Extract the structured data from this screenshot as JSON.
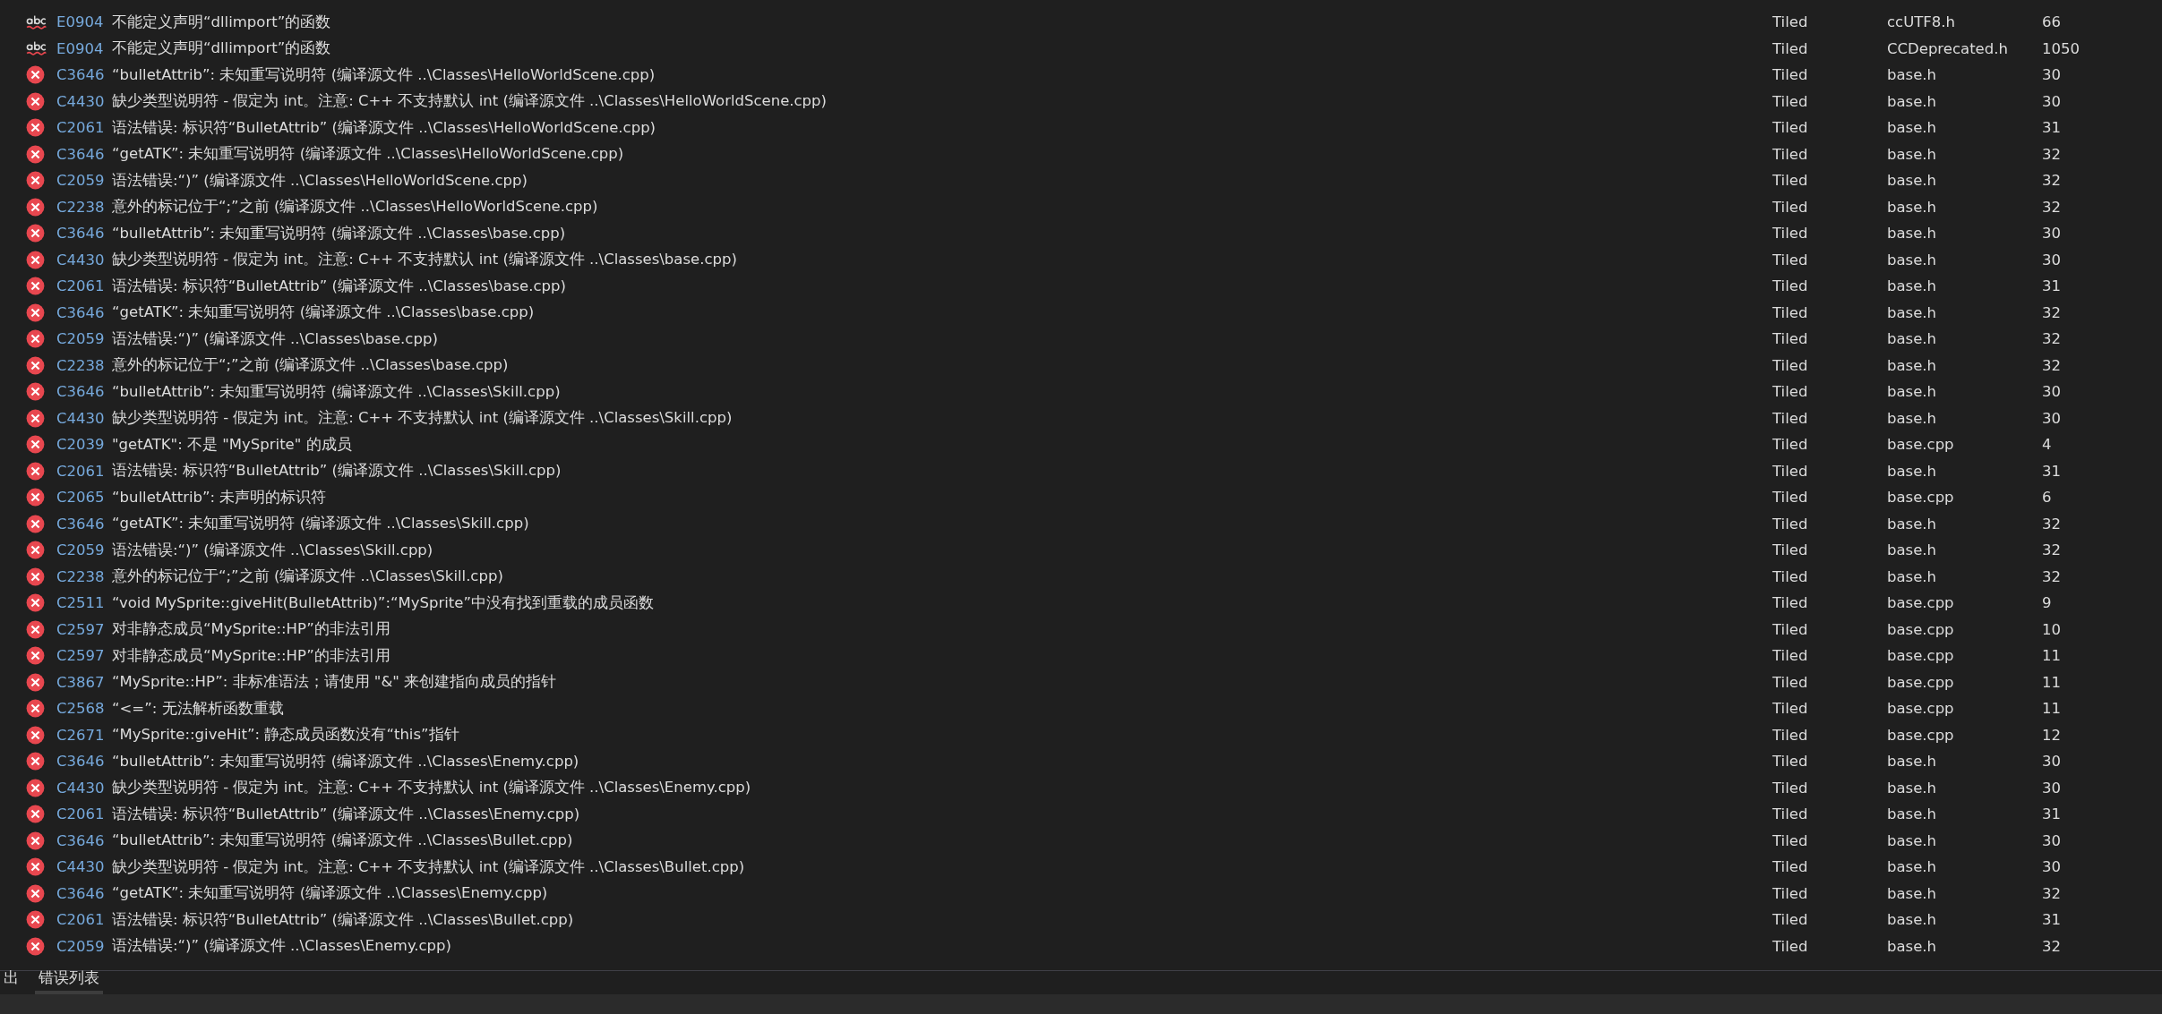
{
  "rows": [
    {
      "kind": "intellisense",
      "code": "E0904",
      "description": "不能定义声明“dllimport”的函数",
      "project": "Tiled",
      "file": "ccUTF8.h",
      "line": "66"
    },
    {
      "kind": "intellisense",
      "code": "E0904",
      "description": "不能定义声明“dllimport”的函数",
      "project": "Tiled",
      "file": "CCDeprecated.h",
      "line": "1050"
    },
    {
      "kind": "error",
      "code": "C3646",
      "description": "“bulletAttrib”: 未知重写说明符 (编译源文件 ..\\Classes\\HelloWorldScene.cpp)",
      "project": "Tiled",
      "file": "base.h",
      "line": "30"
    },
    {
      "kind": "error",
      "code": "C4430",
      "description": "缺少类型说明符 - 假定为 int。注意: C++ 不支持默认 int (编译源文件 ..\\Classes\\HelloWorldScene.cpp)",
      "project": "Tiled",
      "file": "base.h",
      "line": "30"
    },
    {
      "kind": "error",
      "code": "C2061",
      "description": "语法错误: 标识符“BulletAttrib” (编译源文件 ..\\Classes\\HelloWorldScene.cpp)",
      "project": "Tiled",
      "file": "base.h",
      "line": "31"
    },
    {
      "kind": "error",
      "code": "C3646",
      "description": "“getATK”: 未知重写说明符 (编译源文件 ..\\Classes\\HelloWorldScene.cpp)",
      "project": "Tiled",
      "file": "base.h",
      "line": "32"
    },
    {
      "kind": "error",
      "code": "C2059",
      "description": "语法错误:“)” (编译源文件 ..\\Classes\\HelloWorldScene.cpp)",
      "project": "Tiled",
      "file": "base.h",
      "line": "32"
    },
    {
      "kind": "error",
      "code": "C2238",
      "description": "意外的标记位于“;”之前 (编译源文件 ..\\Classes\\HelloWorldScene.cpp)",
      "project": "Tiled",
      "file": "base.h",
      "line": "32"
    },
    {
      "kind": "error",
      "code": "C3646",
      "description": "“bulletAttrib”: 未知重写说明符 (编译源文件 ..\\Classes\\base.cpp)",
      "project": "Tiled",
      "file": "base.h",
      "line": "30"
    },
    {
      "kind": "error",
      "code": "C4430",
      "description": "缺少类型说明符 - 假定为 int。注意: C++ 不支持默认 int (编译源文件 ..\\Classes\\base.cpp)",
      "project": "Tiled",
      "file": "base.h",
      "line": "30"
    },
    {
      "kind": "error",
      "code": "C2061",
      "description": "语法错误: 标识符“BulletAttrib” (编译源文件 ..\\Classes\\base.cpp)",
      "project": "Tiled",
      "file": "base.h",
      "line": "31"
    },
    {
      "kind": "error",
      "code": "C3646",
      "description": "“getATK”: 未知重写说明符 (编译源文件 ..\\Classes\\base.cpp)",
      "project": "Tiled",
      "file": "base.h",
      "line": "32"
    },
    {
      "kind": "error",
      "code": "C2059",
      "description": "语法错误:“)” (编译源文件 ..\\Classes\\base.cpp)",
      "project": "Tiled",
      "file": "base.h",
      "line": "32"
    },
    {
      "kind": "error",
      "code": "C2238",
      "description": "意外的标记位于“;”之前 (编译源文件 ..\\Classes\\base.cpp)",
      "project": "Tiled",
      "file": "base.h",
      "line": "32"
    },
    {
      "kind": "error",
      "code": "C3646",
      "description": "“bulletAttrib”: 未知重写说明符 (编译源文件 ..\\Classes\\Skill.cpp)",
      "project": "Tiled",
      "file": "base.h",
      "line": "30"
    },
    {
      "kind": "error",
      "code": "C4430",
      "description": "缺少类型说明符 - 假定为 int。注意: C++ 不支持默认 int (编译源文件 ..\\Classes\\Skill.cpp)",
      "project": "Tiled",
      "file": "base.h",
      "line": "30"
    },
    {
      "kind": "error",
      "code": "C2039",
      "description": "\"getATK\": 不是 \"MySprite\" 的成员",
      "project": "Tiled",
      "file": "base.cpp",
      "line": "4"
    },
    {
      "kind": "error",
      "code": "C2061",
      "description": "语法错误: 标识符“BulletAttrib” (编译源文件 ..\\Classes\\Skill.cpp)",
      "project": "Tiled",
      "file": "base.h",
      "line": "31"
    },
    {
      "kind": "error",
      "code": "C2065",
      "description": "“bulletAttrib”: 未声明的标识符",
      "project": "Tiled",
      "file": "base.cpp",
      "line": "6"
    },
    {
      "kind": "error",
      "code": "C3646",
      "description": "“getATK”: 未知重写说明符 (编译源文件 ..\\Classes\\Skill.cpp)",
      "project": "Tiled",
      "file": "base.h",
      "line": "32"
    },
    {
      "kind": "error",
      "code": "C2059",
      "description": "语法错误:“)” (编译源文件 ..\\Classes\\Skill.cpp)",
      "project": "Tiled",
      "file": "base.h",
      "line": "32"
    },
    {
      "kind": "error",
      "code": "C2238",
      "description": "意外的标记位于“;”之前 (编译源文件 ..\\Classes\\Skill.cpp)",
      "project": "Tiled",
      "file": "base.h",
      "line": "32"
    },
    {
      "kind": "error",
      "code": "C2511",
      "description": "“void MySprite::giveHit(BulletAttrib)”:“MySprite”中没有找到重载的成员函数",
      "project": "Tiled",
      "file": "base.cpp",
      "line": "9"
    },
    {
      "kind": "error",
      "code": "C2597",
      "description": "对非静态成员“MySprite::HP”的非法引用",
      "project": "Tiled",
      "file": "base.cpp",
      "line": "10"
    },
    {
      "kind": "error",
      "code": "C2597",
      "description": "对非静态成员“MySprite::HP”的非法引用",
      "project": "Tiled",
      "file": "base.cpp",
      "line": "11"
    },
    {
      "kind": "error",
      "code": "C3867",
      "description": "“MySprite::HP”: 非标准语法；请使用 \"&\" 来创建指向成员的指针",
      "project": "Tiled",
      "file": "base.cpp",
      "line": "11"
    },
    {
      "kind": "error",
      "code": "C2568",
      "description": "“<=”: 无法解析函数重载",
      "project": "Tiled",
      "file": "base.cpp",
      "line": "11"
    },
    {
      "kind": "error",
      "code": "C2671",
      "description": "“MySprite::giveHit”: 静态成员函数没有“this”指针",
      "project": "Tiled",
      "file": "base.cpp",
      "line": "12"
    },
    {
      "kind": "error",
      "code": "C3646",
      "description": "“bulletAttrib”: 未知重写说明符 (编译源文件 ..\\Classes\\Enemy.cpp)",
      "project": "Tiled",
      "file": "base.h",
      "line": "30"
    },
    {
      "kind": "error",
      "code": "C4430",
      "description": "缺少类型说明符 - 假定为 int。注意: C++ 不支持默认 int (编译源文件 ..\\Classes\\Enemy.cpp)",
      "project": "Tiled",
      "file": "base.h",
      "line": "30"
    },
    {
      "kind": "error",
      "code": "C2061",
      "description": "语法错误: 标识符“BulletAttrib” (编译源文件 ..\\Classes\\Enemy.cpp)",
      "project": "Tiled",
      "file": "base.h",
      "line": "31"
    },
    {
      "kind": "error",
      "code": "C3646",
      "description": "“bulletAttrib”: 未知重写说明符 (编译源文件 ..\\Classes\\Bullet.cpp)",
      "project": "Tiled",
      "file": "base.h",
      "line": "30"
    },
    {
      "kind": "error",
      "code": "C4430",
      "description": "缺少类型说明符 - 假定为 int。注意: C++ 不支持默认 int (编译源文件 ..\\Classes\\Bullet.cpp)",
      "project": "Tiled",
      "file": "base.h",
      "line": "30"
    },
    {
      "kind": "error",
      "code": "C3646",
      "description": "“getATK”: 未知重写说明符 (编译源文件 ..\\Classes\\Enemy.cpp)",
      "project": "Tiled",
      "file": "base.h",
      "line": "32"
    },
    {
      "kind": "error",
      "code": "C2061",
      "description": "语法错误: 标识符“BulletAttrib” (编译源文件 ..\\Classes\\Bullet.cpp)",
      "project": "Tiled",
      "file": "base.h",
      "line": "31"
    },
    {
      "kind": "error",
      "code": "C2059",
      "description": "语法错误:“)” (编译源文件 ..\\Classes\\Enemy.cpp)",
      "project": "Tiled",
      "file": "base.h",
      "line": "32"
    }
  ],
  "tabs": [
    {
      "label": "出",
      "selected": false
    },
    {
      "label": "错误列表",
      "selected": true
    }
  ]
}
